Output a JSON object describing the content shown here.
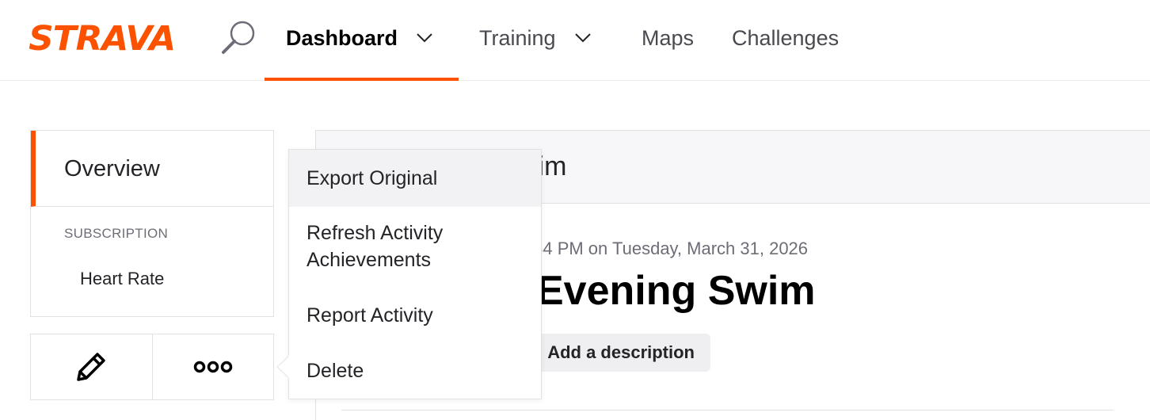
{
  "brand": {
    "logo_text": "STRAVA",
    "accent": "#fc5200"
  },
  "nav": {
    "dashboard": "Dashboard",
    "training": "Training",
    "maps": "Maps",
    "challenges": "Challenges"
  },
  "sidebar": {
    "overview": "Overview",
    "subscription_heading": "SUBSCRIPTION",
    "heart_rate": "Heart Rate"
  },
  "activity": {
    "header_title_partial": "wim",
    "date_partial": ":34 PM on Tuesday, March 31, 2026",
    "name_partial": "Evening Swim",
    "add_description": "Add a description"
  },
  "menu": {
    "export_original": "Export Original",
    "refresh_line1": "Refresh Activity",
    "refresh_line2": "Achievements",
    "report": "Report Activity",
    "delete": "Delete"
  },
  "icons": {
    "search": "search-icon",
    "chevron": "chevron-down-icon",
    "edit": "pencil-icon",
    "more": "more-icon"
  }
}
